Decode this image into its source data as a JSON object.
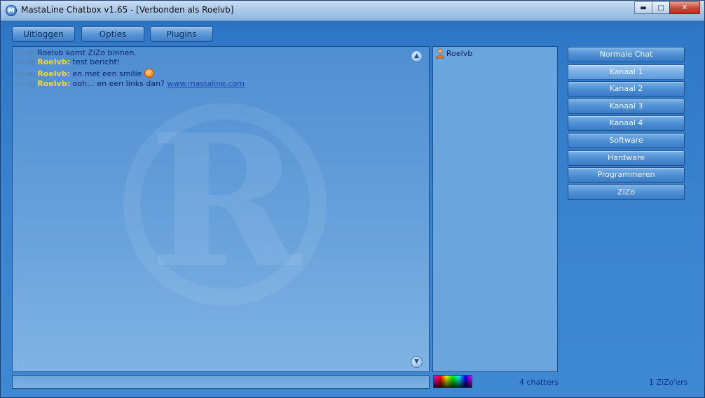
{
  "window": {
    "title": "MastaLine Chatbox v1.65 - [Verbonden als Roelvb]",
    "app_icon": "M"
  },
  "window_controls": {
    "minimize": "▬",
    "maximize": "□",
    "close": "✕"
  },
  "toolbar": {
    "logout": "Uitloggen",
    "options": "Opties",
    "plugins": "Plugins"
  },
  "chat": {
    "messages": [
      {
        "time": "[14:48]",
        "nick": "",
        "text": "Roelvb komt ZiZo binnen."
      },
      {
        "time": "[14:48]",
        "nick": "Roelvb:",
        "text": "test bericht!"
      },
      {
        "time": "[14:48]",
        "nick": "Roelvb:",
        "text": "en met een smilie"
      },
      {
        "time": "[14:48]",
        "nick": "Roelvb:",
        "text": "ooh… en een links dan?",
        "link": "www.mastaline.com"
      }
    ],
    "scroll_up": "▲",
    "scroll_down": "▼"
  },
  "users": {
    "list": [
      "Roelvb"
    ],
    "count": "4 chatters"
  },
  "channels": [
    "Normale Chat",
    "Kanaal 1",
    "Kanaal 2",
    "Kanaal 3",
    "Kanaal 4",
    "Software",
    "Hardware",
    "Programmeren",
    "ZiZo"
  ],
  "channel_status": "1 ZiZo'ers",
  "colors": {
    "nick": "#f7d53a",
    "text": "#0b1f66",
    "link": "#1d3fb0"
  },
  "icons": {
    "user": "user-icon",
    "smilie": "smilie-icon",
    "color_picker": "color-picker"
  }
}
